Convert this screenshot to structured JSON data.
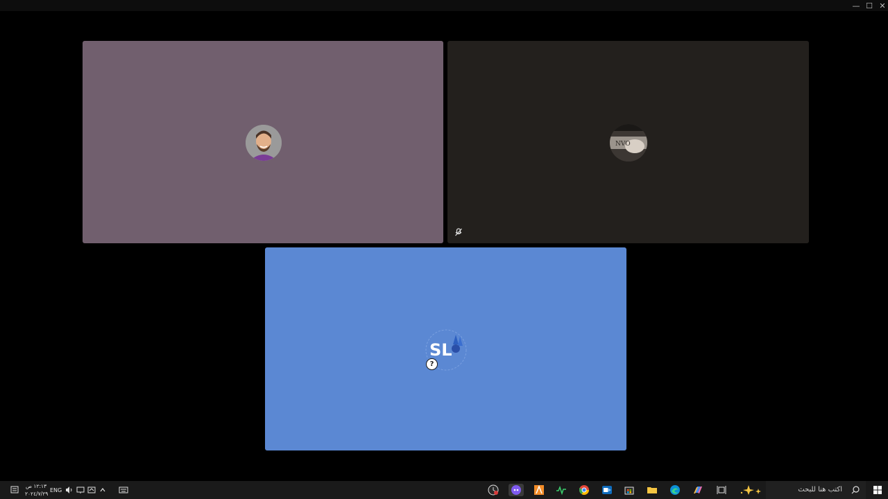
{
  "window": {
    "controls": {
      "minimize": "—",
      "maximize": "☐",
      "close": "✕"
    }
  },
  "participants": [
    {
      "name_icon": "cartoon-avatar",
      "background": "#715f6e"
    },
    {
      "name_icon": "photo-avatar",
      "background": "#23201d",
      "avatar_text": "NVO",
      "status_icon": "mic-off-icon"
    },
    {
      "name_icon": "sl-logo-avatar",
      "background": "#5b88d3",
      "avatar_text": "SL",
      "badge": "?"
    }
  ],
  "taskbar": {
    "search_placeholder": "اكتب هنا للبحث",
    "language": "ENG",
    "time": "١٢:١٣ ص",
    "date": "٢٠٢٤/٧/٢٩",
    "apps": [
      "clock-icon",
      "discord-icon",
      "autodesk-icon",
      "monitor-icon",
      "chrome-icon",
      "outlook-icon",
      "store-icon",
      "folder-icon",
      "edge-icon",
      "copilot-icon",
      "taskview-icon",
      "spark-widget-icon"
    ]
  },
  "colors": {
    "accent": "#5b88d3",
    "taskbar": "#1a1a1a"
  }
}
